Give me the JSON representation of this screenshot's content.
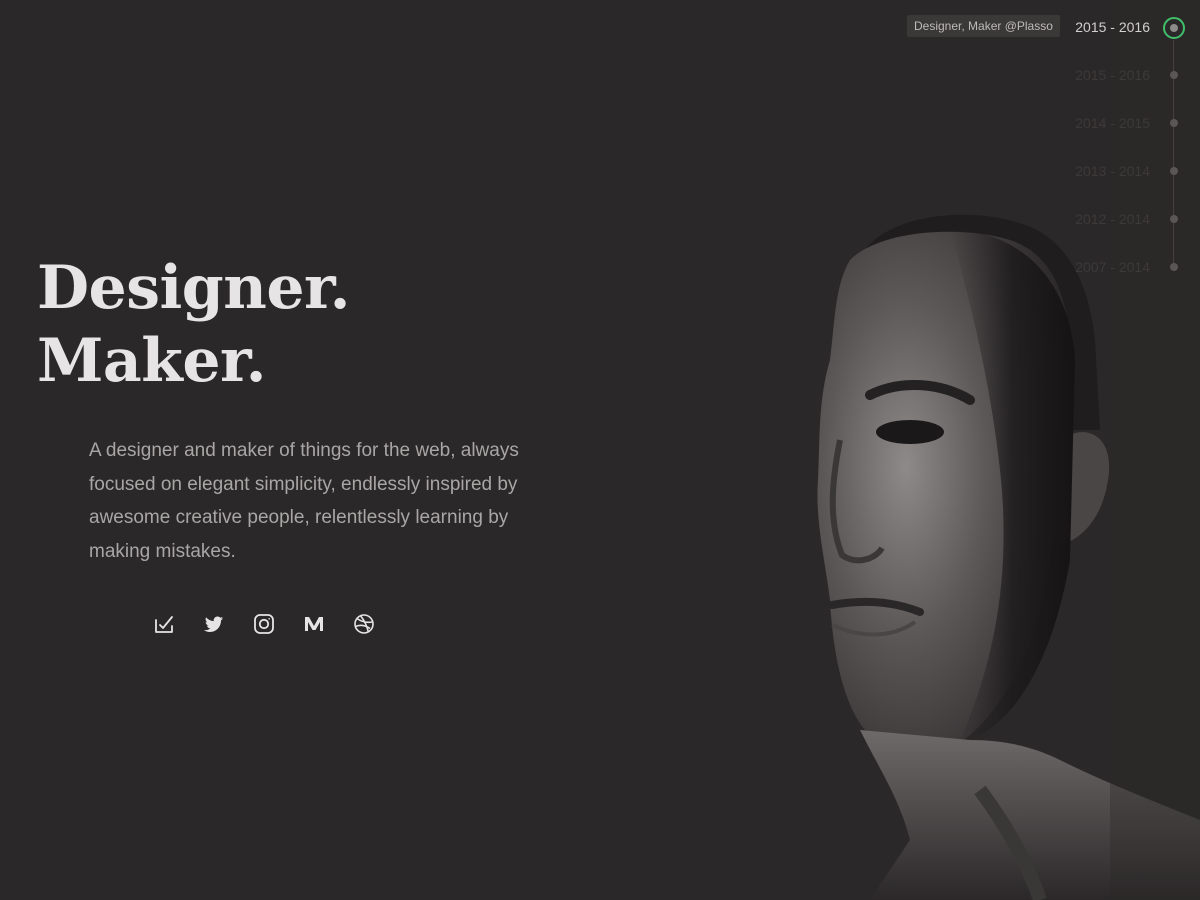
{
  "hero": {
    "headline_line1": "Designer.",
    "headline_line2": "Maker.",
    "intro": "A designer and maker of things for the web, always focused on elegant simplicity, endlessly inspired by awesome creative people, relentlessly learning by making mistakes."
  },
  "socials": [
    {
      "name": "plasso-icon"
    },
    {
      "name": "twitter-icon"
    },
    {
      "name": "instagram-icon"
    },
    {
      "name": "medium-icon"
    },
    {
      "name": "dribbble-icon"
    }
  ],
  "timeline": {
    "active_role": "Designer, Maker @Plasso",
    "items": [
      {
        "label": "2015 - 2016",
        "active": true
      },
      {
        "label": "2015 - 2016",
        "active": false
      },
      {
        "label": "2014 - 2015",
        "active": false
      },
      {
        "label": "2013 - 2014",
        "active": false
      },
      {
        "label": "2012 - 2014",
        "active": false
      },
      {
        "label": "2007 - 2014",
        "active": false
      }
    ]
  },
  "colors": {
    "background": "#2b2829",
    "headline": "#e6e4e4",
    "body_text": "#a9a6a6",
    "accent": "#3fbf6a"
  }
}
